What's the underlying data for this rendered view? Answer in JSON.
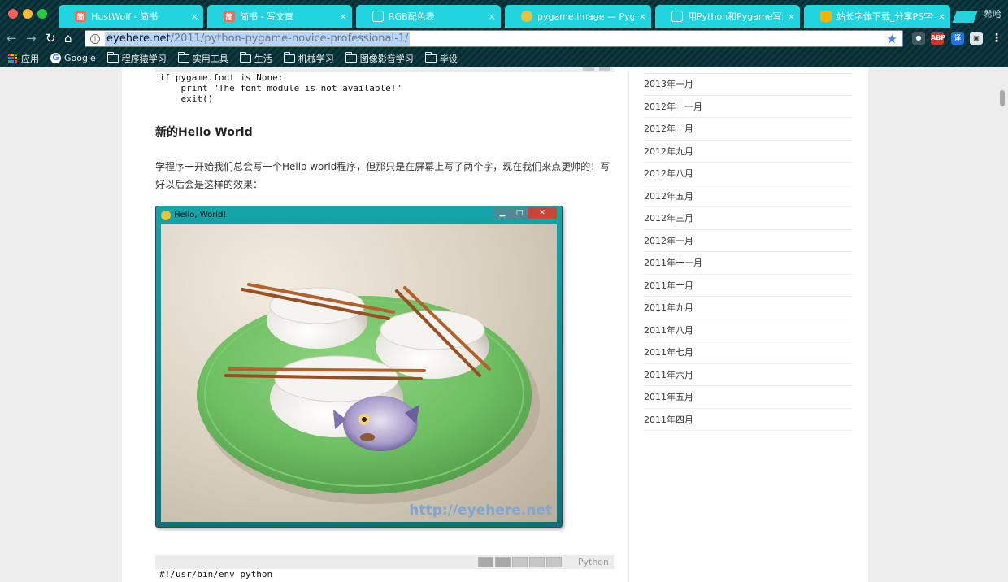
{
  "tabs": [
    {
      "title": "HustWolf - 简书",
      "favicon": "简",
      "favicon_color": "#ea6f5a"
    },
    {
      "title": "简书 - 写文章",
      "favicon": "简",
      "favicon_color": "#ea6f5a"
    },
    {
      "title": "RGB配色表",
      "favicon": "doc",
      "favicon_color": "#ffffff"
    },
    {
      "title": "pygame.image — Pygame v",
      "favicon": "snake",
      "favicon_color": "#e8c23a"
    },
    {
      "title": "用Python和Pygame写游戏-",
      "favicon": "doc",
      "favicon_color": "#ffffff"
    },
    {
      "title": "站长字体下载_分享PS字体,",
      "favicon": "font",
      "favicon_color": "#f2b400"
    }
  ],
  "tab_close_glyph": "×",
  "corner_glyph": "希哈",
  "toolbar": {
    "url_host": "eyehere.net",
    "url_path": "/2011/python-pygame-novice-professional-1/",
    "extensions": [
      "ghost-icon",
      "abp-icon",
      "translate-icon",
      "window-icon",
      "menu-icon"
    ]
  },
  "bookmarks": [
    {
      "label": "应用",
      "icon": "apps-grid-icon"
    },
    {
      "label": "Google",
      "icon": "google-icon"
    },
    {
      "label": "程序猿学习",
      "icon": "folder-icon"
    },
    {
      "label": "实用工具",
      "icon": "folder-icon"
    },
    {
      "label": "生活",
      "icon": "folder-icon"
    },
    {
      "label": "机械学习",
      "icon": "folder-icon"
    },
    {
      "label": "图像影音学习",
      "icon": "folder-icon"
    },
    {
      "label": "毕设",
      "icon": "folder-icon"
    }
  ],
  "article": {
    "code_top": "if pygame.font is None:\n    print \"The font module is not available!\"\n    exit()",
    "heading": "新的Hello World",
    "paragraph": "学程序一开始我们总会写一个Hello world程序，但那只是在屏幕上写了两个字，现在我们来点更帅的！写好以后会是这样的效果：",
    "screenshot": {
      "window_title": "Hello, World!",
      "watermark": "http://eyehere.net",
      "min_glyph": "▁",
      "max_glyph": "□",
      "close_glyph": "✕"
    },
    "code_language": "Python",
    "code_bottom": "#!/usr/bin/env python"
  },
  "sidebar": {
    "archive": [
      "2013年一月",
      "2012年十一月",
      "2012年十月",
      "2012年九月",
      "2012年八月",
      "2012年五月",
      "2012年三月",
      "2012年一月",
      "2011年十一月",
      "2011年十月",
      "2011年九月",
      "2011年八月",
      "2011年七月",
      "2011年六月",
      "2011年五月",
      "2011年四月"
    ]
  },
  "colors": {
    "tab_bg": "#22d4e0",
    "accent_blue": "#3b82f0",
    "plate_green": "#6fbf63"
  }
}
